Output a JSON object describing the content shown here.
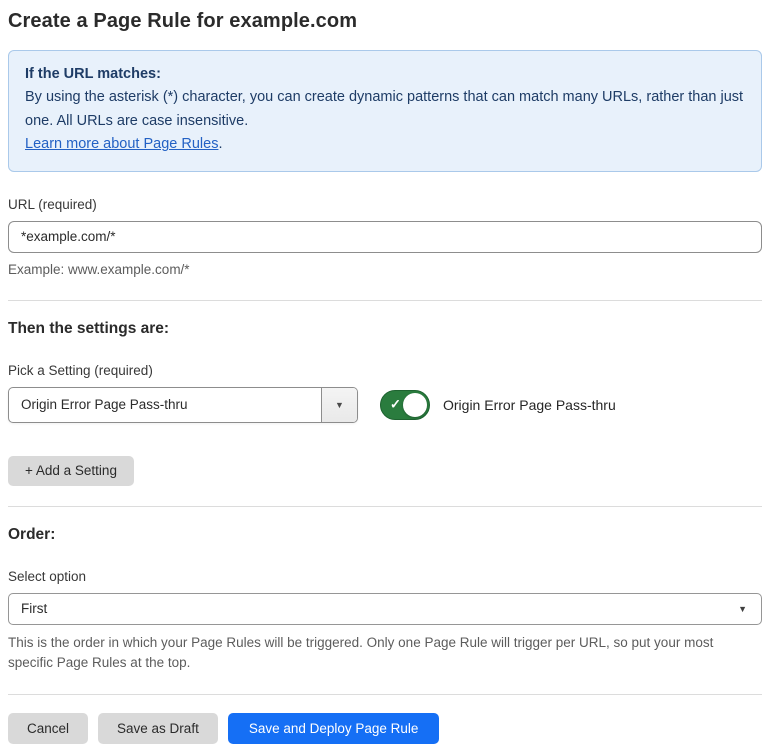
{
  "page": {
    "title": "Create a Page Rule for example.com"
  },
  "info_box": {
    "heading": "If the URL matches:",
    "body": "By using the asterisk (*) character, you can create dynamic patterns that can match many URLs, rather than just one. All URLs are case insensitive.",
    "link_label": "Learn more about Page Rules",
    "link_suffix": "."
  },
  "url_field": {
    "label": "URL (required)",
    "value": "*example.com/*",
    "helper": "Example: www.example.com/*"
  },
  "settings_section": {
    "heading": "Then the settings are:",
    "picker_label": "Pick a Setting (required)",
    "picker_value": "Origin Error Page Pass-thru",
    "toggle_state": "on",
    "toggle_label": "Origin Error Page Pass-thru",
    "add_setting_label": "+ Add a Setting"
  },
  "order_section": {
    "heading": "Order:",
    "select_label": "Select option",
    "select_value": "First",
    "helper": "This is the order in which your Page Rules will be triggered. Only one Page Rule will trigger per URL, so put your most specific Page Rules at the top."
  },
  "footer": {
    "cancel_label": "Cancel",
    "save_draft_label": "Save as Draft",
    "save_deploy_label": "Save and Deploy Page Rule"
  },
  "icons": {
    "dropdown_caret": "▼",
    "select_caret": "▼",
    "toggle_check": "✓"
  },
  "colors": {
    "primary_blue": "#156ff5",
    "link_blue": "#2361c4",
    "info_background": "#e8f1fb",
    "info_border": "#aac9ea",
    "info_text": "#1e3c66",
    "toggle_green": "#2a7c3e",
    "button_gray": "#d9d9d9"
  }
}
